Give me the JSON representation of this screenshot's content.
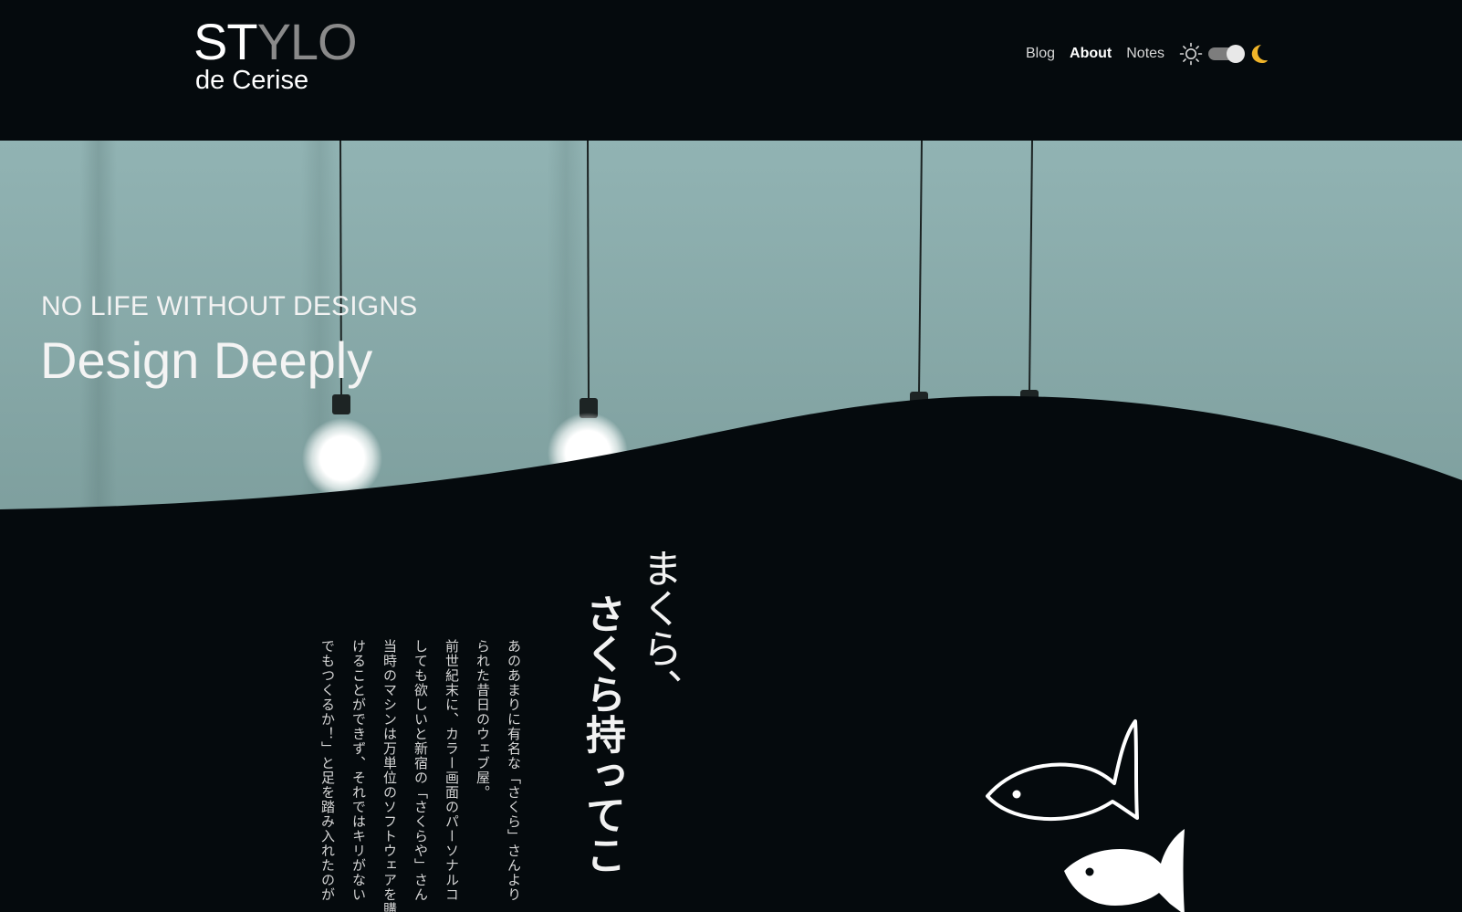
{
  "header": {
    "logo": {
      "main_light": "ST",
      "main_dark": "YLO",
      "sub": "de Cerise"
    },
    "nav": {
      "items": [
        {
          "label": "Blog",
          "active": false
        },
        {
          "label": "About",
          "active": true
        },
        {
          "label": "Notes",
          "active": false
        }
      ]
    },
    "theme": {
      "light_icon": "sun-icon",
      "dark_icon": "moon-icon",
      "mode": "dark",
      "moon_color": "#f0b429"
    }
  },
  "hero": {
    "kicker": "NO LIFE WITHOUT DESIGNS",
    "title": "Design Deeply",
    "background_color": "#86a9a8"
  },
  "article": {
    "title_line1": "まくら、",
    "title_line2": "さくら持ってこ",
    "paragraph_lines": [
      "あのあまりに有名な「さくら」さんより",
      "られた昔日のウェブ屋。",
      "前世紀末に、カラー画面のパーソナルコ",
      "しても欲しいと新宿の「さくらや」さん",
      "当時のマシンは万単位のソフトウェアを購",
      "けることができず、それではキリがない",
      "でもつくるか！」と足を踏み入れたのが"
    ]
  },
  "decor": {
    "fish_icon_1": "fish-outline-icon",
    "fish_icon_2": "fish-filled-icon"
  }
}
